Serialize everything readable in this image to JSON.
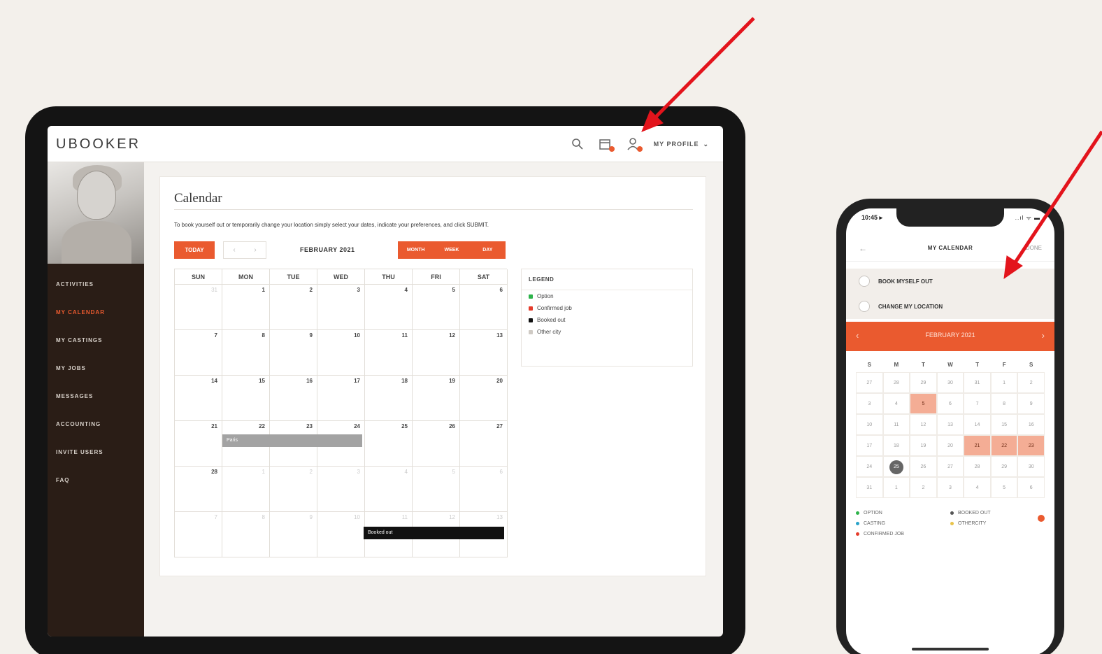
{
  "colors": {
    "accent": "#ea5a2f",
    "arrow": "#e3141c",
    "sidebar": "#2a1d16"
  },
  "tablet": {
    "logo": "UBOOKER",
    "header": {
      "icons": [
        "search-icon",
        "calendar-icon",
        "profile-alert-icon"
      ],
      "profile_label": "MY PROFILE"
    },
    "nav": [
      "ACTIVITIES",
      "MY CALENDAR",
      "MY CASTINGS",
      "MY JOBS",
      "MESSAGES",
      "ACCOUNTING",
      "INVITE USERS",
      "FAQ"
    ],
    "nav_active": "MY CALENDAR",
    "calendar": {
      "title": "Calendar",
      "instructions": "To book yourself out or temporarily change your location simply select your dates, indicate your preferences, and click SUBMIT.",
      "today_label": "TODAY",
      "prev": "‹",
      "next": "›",
      "month": "FEBRUARY 2021",
      "views": [
        "MONTH",
        "WEEK",
        "DAY"
      ],
      "weekdays": [
        "SUN",
        "MON",
        "TUE",
        "WED",
        "THU",
        "FRI",
        "SAT"
      ],
      "weeks": [
        [
          {
            "d": "31",
            "m": true
          },
          {
            "d": "1"
          },
          {
            "d": "2"
          },
          {
            "d": "3"
          },
          {
            "d": "4"
          },
          {
            "d": "5"
          },
          {
            "d": "6"
          }
        ],
        [
          {
            "d": "7"
          },
          {
            "d": "8"
          },
          {
            "d": "9"
          },
          {
            "d": "10"
          },
          {
            "d": "11"
          },
          {
            "d": "12"
          },
          {
            "d": "13"
          }
        ],
        [
          {
            "d": "14"
          },
          {
            "d": "15"
          },
          {
            "d": "16"
          },
          {
            "d": "17"
          },
          {
            "d": "18"
          },
          {
            "d": "19"
          },
          {
            "d": "20"
          }
        ],
        [
          {
            "d": "21"
          },
          {
            "d": "22"
          },
          {
            "d": "23"
          },
          {
            "d": "24"
          },
          {
            "d": "25"
          },
          {
            "d": "26"
          },
          {
            "d": "27"
          }
        ],
        [
          {
            "d": "28"
          },
          {
            "d": "1",
            "m": true
          },
          {
            "d": "2",
            "m": true
          },
          {
            "d": "3",
            "m": true
          },
          {
            "d": "4",
            "m": true
          },
          {
            "d": "5",
            "m": true
          },
          {
            "d": "6",
            "m": true
          }
        ],
        [
          {
            "d": "7",
            "m": true
          },
          {
            "d": "8",
            "m": true
          },
          {
            "d": "9",
            "m": true
          },
          {
            "d": "10",
            "m": true
          },
          {
            "d": "11",
            "m": true
          },
          {
            "d": "12",
            "m": true
          },
          {
            "d": "13",
            "m": true
          }
        ]
      ],
      "events": {
        "gray": "Paris",
        "black": "Booked out"
      },
      "legend": {
        "title": "LEGEND",
        "items": [
          {
            "label": "Option",
            "color": "#2db34a"
          },
          {
            "label": "Confirmed job",
            "color": "#e53c2b"
          },
          {
            "label": "Booked out",
            "color": "#111111"
          },
          {
            "label": "Other city",
            "color": "#cfcac4"
          }
        ]
      }
    }
  },
  "phone": {
    "time": "10:45 ▸",
    "status": "..ıl ᯤ ▬",
    "back": "←",
    "title": "MY CALENDAR",
    "done": "DONE",
    "options": [
      "BOOK MYSELF OUT",
      "CHANGE MY LOCATION"
    ],
    "month": "FEBRUARY 2021",
    "prev": "‹",
    "next": "›",
    "weekdays": [
      "S",
      "M",
      "T",
      "W",
      "T",
      "F",
      "S"
    ],
    "weeks": [
      [
        {
          "d": "27"
        },
        {
          "d": "28"
        },
        {
          "d": "29"
        },
        {
          "d": "30"
        },
        {
          "d": "31"
        },
        {
          "d": "1"
        },
        {
          "d": "2"
        }
      ],
      [
        {
          "d": "3"
        },
        {
          "d": "4"
        },
        {
          "d": "5",
          "hl": true
        },
        {
          "d": "6"
        },
        {
          "d": "7"
        },
        {
          "d": "8"
        },
        {
          "d": "9"
        }
      ],
      [
        {
          "d": "10"
        },
        {
          "d": "11"
        },
        {
          "d": "12"
        },
        {
          "d": "13"
        },
        {
          "d": "14"
        },
        {
          "d": "15"
        },
        {
          "d": "16"
        }
      ],
      [
        {
          "d": "17"
        },
        {
          "d": "18"
        },
        {
          "d": "19"
        },
        {
          "d": "20"
        },
        {
          "d": "21",
          "hl": true
        },
        {
          "d": "22",
          "hl": true
        },
        {
          "d": "23",
          "hl": true
        }
      ],
      [
        {
          "d": "24"
        },
        {
          "d": "25",
          "sel": true
        },
        {
          "d": "26"
        },
        {
          "d": "27"
        },
        {
          "d": "28"
        },
        {
          "d": "29"
        },
        {
          "d": "30"
        }
      ],
      [
        {
          "d": "31"
        },
        {
          "d": "1"
        },
        {
          "d": "2"
        },
        {
          "d": "3"
        },
        {
          "d": "4"
        },
        {
          "d": "5"
        },
        {
          "d": "6"
        }
      ]
    ],
    "legend": [
      {
        "label": "OPTION",
        "color": "#2db34a"
      },
      {
        "label": "BOOKED OUT",
        "color": "#555555"
      },
      {
        "label": "CASTING",
        "color": "#2aa3c9"
      },
      {
        "label": "OTHERCITY",
        "color": "#e8c34a"
      },
      {
        "label": "CONFIRMED JOB",
        "color": "#e53c2b"
      }
    ]
  }
}
